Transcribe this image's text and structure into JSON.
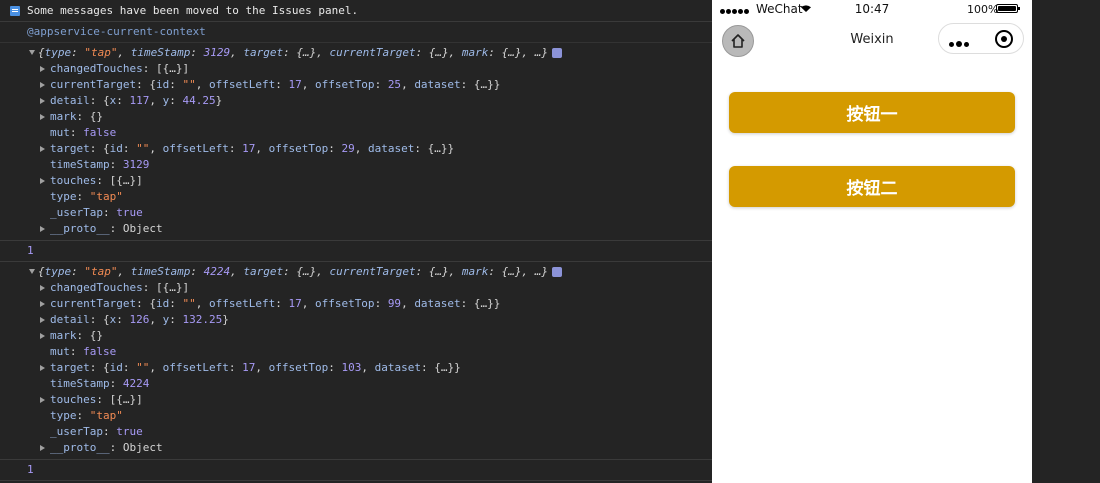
{
  "console": {
    "issues_message": "Some messages have been moved to the Issues panel.",
    "context": "@appservice-current-context",
    "entries": [
      {
        "summary": {
          "type_str": "\"tap\"",
          "timestamp": "3129"
        },
        "props": {
          "changedTouches": "[{…}]",
          "currentTarget": {
            "id": "\"\"",
            "offsetLeft": "17",
            "offsetTop": "25",
            "dataset": "{…}"
          },
          "detail": {
            "x": "117",
            "y": "44.25"
          },
          "mark": "{}",
          "mut": "false",
          "target": {
            "id": "\"\"",
            "offsetLeft": "17",
            "offsetTop": "29",
            "dataset": "{…}"
          },
          "timeStamp": "3129",
          "touches": "[{…}]",
          "type": "\"tap\"",
          "userTap": "true",
          "proto": "Object"
        },
        "result": "1"
      },
      {
        "summary": {
          "type_str": "\"tap\"",
          "timestamp": "4224"
        },
        "props": {
          "changedTouches": "[{…}]",
          "currentTarget": {
            "id": "\"\"",
            "offsetLeft": "17",
            "offsetTop": "99",
            "dataset": "{…}"
          },
          "detail": {
            "x": "126",
            "y": "132.25"
          },
          "mark": "{}",
          "mut": "false",
          "target": {
            "id": "\"\"",
            "offsetLeft": "17",
            "offsetTop": "103",
            "dataset": "{…}"
          },
          "timeStamp": "4224",
          "touches": "[{…}]",
          "type": "\"tap\"",
          "userTap": "true",
          "proto": "Object"
        },
        "result": "1"
      }
    ],
    "labels": {
      "type": "type",
      "timeStamp": "timeStamp",
      "target": "target",
      "currentTarget": "currentTarget",
      "mark": "mark",
      "collapsed": "{…}",
      "ellipsis": "…",
      "changedTouches": "changedTouches",
      "detail": "detail",
      "mut": "mut",
      "touches": "touches",
      "userTap": "_userTap",
      "proto": "__proto__",
      "id": "id",
      "offsetLeft": "offsetLeft",
      "offsetTop": "offsetTop",
      "dataset": "dataset",
      "x": "x",
      "y": "y"
    }
  },
  "phone": {
    "status": {
      "carrier": "WeChat",
      "time": "10:47",
      "battery": "100%"
    },
    "nav": {
      "title": "Weixin"
    },
    "buttons": {
      "first": "按钮一",
      "second": "按钮二"
    }
  },
  "colors": {
    "button_bg": "#d49a00",
    "console_bg": "#242424",
    "string_value": "#f28b54",
    "number_value": "#a79af5"
  }
}
